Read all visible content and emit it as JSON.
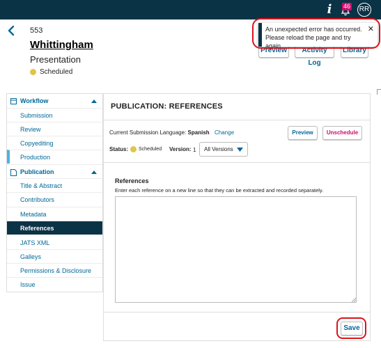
{
  "topbar": {
    "notifications_count": "46",
    "avatar_initials": "RR"
  },
  "submission": {
    "id": "553",
    "author": "Whittingham",
    "type": "Presentation",
    "status": "Scheduled"
  },
  "header_buttons": {
    "preview": "Preview",
    "activity_log": "Activity Log",
    "library": "Library"
  },
  "toast": {
    "line1": "An unexpected error has occurred.",
    "line2": "Please reload the page and try again."
  },
  "sidebar": {
    "workflow": {
      "label": "Workflow",
      "items": [
        "Submission",
        "Review",
        "Copyediting",
        "Production"
      ]
    },
    "publication": {
      "label": "Publication",
      "items": [
        "Title & Abstract",
        "Contributors",
        "Metadata",
        "References",
        "JATS XML",
        "Galleys",
        "Permissions & Disclosure",
        "Issue"
      ]
    }
  },
  "main": {
    "title": "PUBLICATION: REFERENCES",
    "language_label": "Current Submission Language:",
    "language_value": "Spanish",
    "change_link": "Change",
    "preview_button": "Preview",
    "unschedule_button": "Unschedule",
    "status_label": "Status:",
    "status_value": "Scheduled",
    "version_label": "Version:",
    "version_value": "1",
    "all_versions": "All Versions",
    "references_label": "References",
    "references_description": "Enter each reference on a new line so that they can be extracted and recorded separately.",
    "references_value": "",
    "save_button": "Save"
  },
  "colors": {
    "topbar": "#0b3346",
    "link": "#006798",
    "scheduled": "#e0c54a",
    "danger": "#d00a6c",
    "highlight": "#d8141c"
  }
}
